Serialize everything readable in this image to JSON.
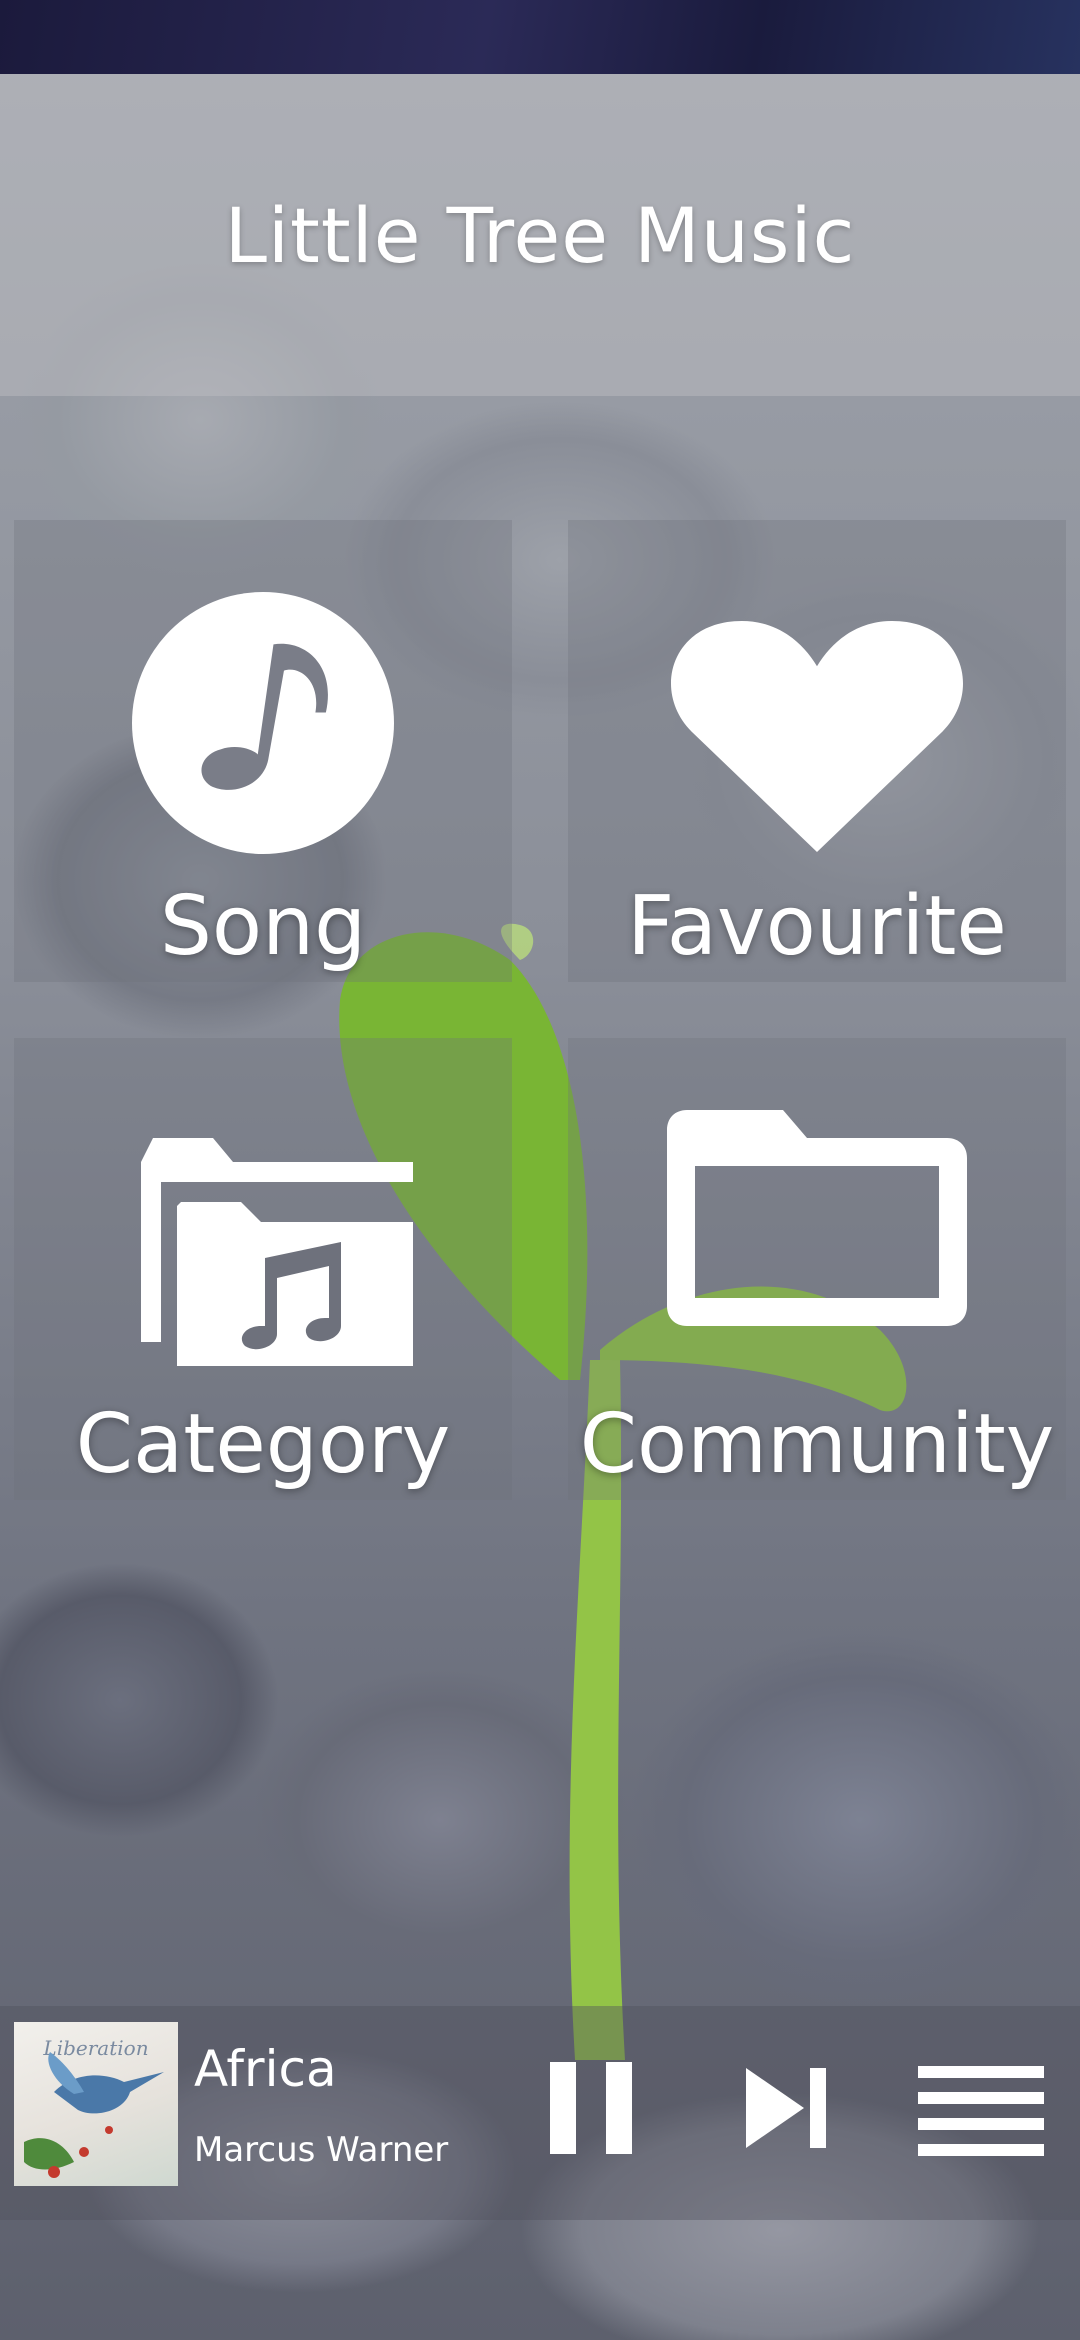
{
  "app": {
    "title": "Little Tree Music"
  },
  "menu": {
    "items": [
      {
        "label": "Song",
        "icon": "music-note-icon"
      },
      {
        "label": "Favourite",
        "icon": "heart-icon"
      },
      {
        "label": "Category",
        "icon": "music-folder-icon"
      },
      {
        "label": "Community",
        "icon": "folder-icon"
      }
    ]
  },
  "player": {
    "album_art_text": "Liberation",
    "track_title": "Africa",
    "artist": "Marcus Warner",
    "controls": {
      "pause_icon": "pause-icon",
      "next_icon": "skip-next-icon",
      "menu_icon": "hamburger-menu-icon"
    }
  },
  "colors": {
    "text": "#ffffff",
    "status_strip": "#1b1a3c",
    "sprout_green": "#8cc63f"
  }
}
